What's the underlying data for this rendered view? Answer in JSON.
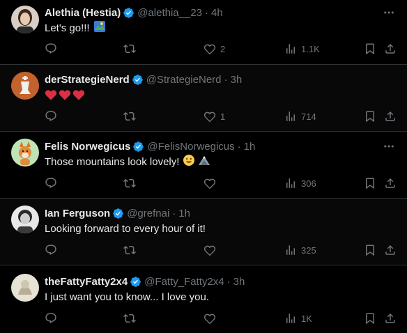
{
  "colors": {
    "background": "#000000",
    "text": "#e7e9ea",
    "muted": "#71767b",
    "verified": "#1d9bf0",
    "heart": "#f91880"
  },
  "tweets": [
    {
      "display_name": "Alethia (Hestia)",
      "handle": "@alethia__23",
      "separator": "·",
      "time": "4h",
      "text": "Let's go!!!",
      "replies": "",
      "retweets": "",
      "likes": "2",
      "views": "1.1K"
    },
    {
      "display_name": "derStrategieNerd",
      "handle": "@StrategieNerd",
      "separator": "·",
      "time": "3h",
      "text": "",
      "replies": "",
      "retweets": "",
      "likes": "1",
      "views": "714"
    },
    {
      "display_name": "Felis Norwegicus",
      "handle": "@FelisNorwegicus",
      "separator": "·",
      "time": "1h",
      "text": "Those mountains look lovely!",
      "replies": "",
      "retweets": "",
      "likes": "",
      "views": "306"
    },
    {
      "display_name": "Ian Ferguson",
      "handle": "@grefnai",
      "separator": "·",
      "time": "1h",
      "text": "Looking forward to every hour of it!",
      "replies": "",
      "retweets": "",
      "likes": "",
      "views": "325"
    },
    {
      "display_name": "theFattyFatty2x4",
      "handle": "@Fatty_Fatty2x4",
      "separator": "·",
      "time": "3h",
      "text": "I just want you to know... I love you.",
      "replies": "",
      "retweets": "",
      "likes": "",
      "views": "1K"
    }
  ]
}
